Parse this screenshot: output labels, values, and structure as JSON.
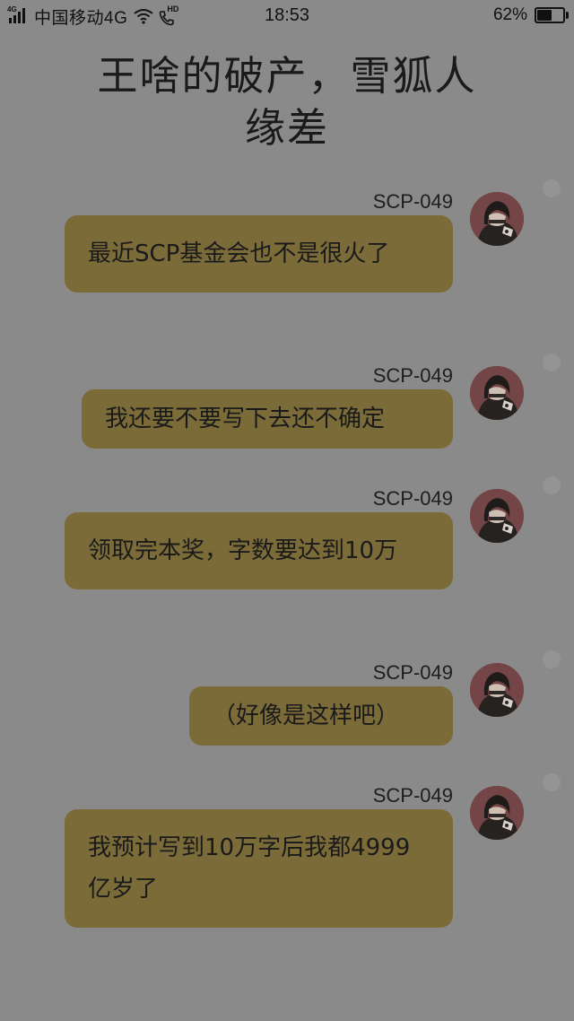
{
  "status_bar": {
    "network_badge": "4G",
    "carrier": "中国移动4G",
    "hd_label": "HD",
    "time": "18:53",
    "battery_percent": "62%",
    "battery_level": 0.62,
    "icons": [
      "signal-icon",
      "wifi-icon",
      "hd-call-icon",
      "battery-icon"
    ]
  },
  "title": {
    "line1": "王啥的破产，雪狐人",
    "line2": "缘差"
  },
  "colors": {
    "background": "#8a8a8a",
    "bubble": "#7a6b38",
    "avatar": "#744546",
    "text": "#1a1a1a"
  },
  "messages": [
    {
      "sender": "SCP-049",
      "text": "最近SCP基金会也不是很火了",
      "avatar": "avatar-icon"
    },
    {
      "sender": "SCP-049",
      "text": "我还要不要写下去还不确定",
      "avatar": "avatar-icon"
    },
    {
      "sender": "SCP-049",
      "text": "领取完本奖，字数要达到10万",
      "avatar": "avatar-icon"
    },
    {
      "sender": "SCP-049",
      "text": "（好像是这样吧）",
      "avatar": "avatar-icon"
    },
    {
      "sender": "SCP-049",
      "text": "我预计写到10万字后我都4999亿岁了",
      "avatar": "avatar-icon"
    }
  ]
}
